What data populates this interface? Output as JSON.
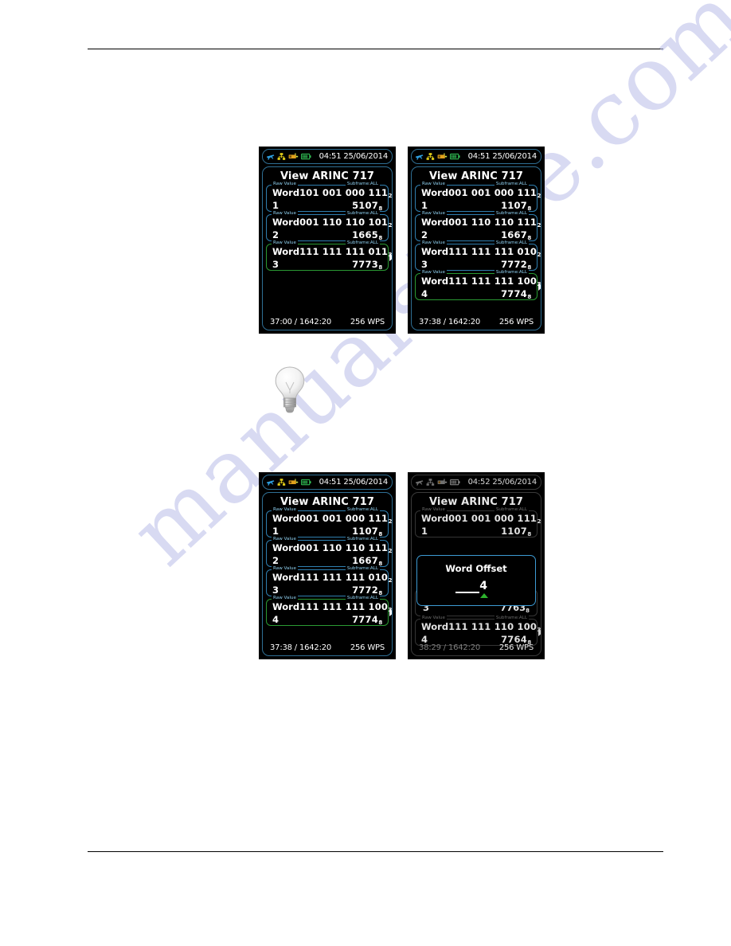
{
  "page": {
    "document_type": "manual-page",
    "watermark_text": "manualshive.com",
    "hint_icon": "light-bulb-icon"
  },
  "screens": [
    {
      "id": "screen-1",
      "position": "top-left",
      "dimmed": false,
      "statusbar": {
        "icons": [
          "airplane-icon",
          "network-icon",
          "device-icon",
          "battery-icon"
        ],
        "clock": "04:51 25/06/2014"
      },
      "title": "View ARINC 717",
      "legend_left": "Raw Value",
      "legend_right": "Subframe:ALL",
      "rows": [
        {
          "label": "Word",
          "index": "1",
          "binary": "101 001 000 111",
          "binary_sub": "2",
          "octal": "5107",
          "octal_sub": "8",
          "selected": false
        },
        {
          "label": "Word",
          "index": "2",
          "binary": "001 110 110 101",
          "binary_sub": "2",
          "octal": "1665",
          "octal_sub": "8",
          "selected": false
        },
        {
          "label": "Word",
          "index": "3",
          "binary": "111 111 111 011",
          "binary_sub": "2",
          "octal": "7773",
          "octal_sub": "8",
          "selected": true
        }
      ],
      "footer": {
        "elapsed": "37:00 / 1642:20",
        "rate": "256 WPS"
      },
      "modal": null
    },
    {
      "id": "screen-2",
      "position": "top-right",
      "dimmed": false,
      "statusbar": {
        "icons": [
          "airplane-icon",
          "network-icon",
          "device-icon",
          "battery-icon"
        ],
        "clock": "04:51 25/06/2014"
      },
      "title": "View ARINC 717",
      "legend_left": "Raw Value",
      "legend_right": "Subframe:ALL",
      "rows": [
        {
          "label": "Word",
          "index": "1",
          "binary": "001 001 000 111",
          "binary_sub": "2",
          "octal": "1107",
          "octal_sub": "8",
          "selected": false
        },
        {
          "label": "Word",
          "index": "2",
          "binary": "001 110 110 111",
          "binary_sub": "2",
          "octal": "1667",
          "octal_sub": "8",
          "selected": false
        },
        {
          "label": "Word",
          "index": "3",
          "binary": "111 111 111 010",
          "binary_sub": "2",
          "octal": "7772",
          "octal_sub": "8",
          "selected": false
        },
        {
          "label": "Word",
          "index": "4",
          "binary": "111 111 111 100",
          "binary_sub": "2",
          "octal": "7774",
          "octal_sub": "8",
          "selected": true
        }
      ],
      "footer": {
        "elapsed": "37:38 / 1642:20",
        "rate": "256 WPS"
      },
      "modal": null
    },
    {
      "id": "screen-3",
      "position": "bottom-left",
      "dimmed": false,
      "statusbar": {
        "icons": [
          "airplane-icon",
          "network-icon",
          "device-icon",
          "battery-icon"
        ],
        "clock": "04:51 25/06/2014"
      },
      "title": "View ARINC 717",
      "legend_left": "Raw Value",
      "legend_right": "Subframe:ALL",
      "rows": [
        {
          "label": "Word",
          "index": "1",
          "binary": "001 001 000 111",
          "binary_sub": "2",
          "octal": "1107",
          "octal_sub": "8",
          "selected": false
        },
        {
          "label": "Word",
          "index": "2",
          "binary": "001 110 110 111",
          "binary_sub": "2",
          "octal": "1667",
          "octal_sub": "8",
          "selected": false
        },
        {
          "label": "Word",
          "index": "3",
          "binary": "111 111 111 010",
          "binary_sub": "2",
          "octal": "7772",
          "octal_sub": "8",
          "selected": false
        },
        {
          "label": "Word",
          "index": "4",
          "binary": "111 111 111 100",
          "binary_sub": "2",
          "octal": "7774",
          "octal_sub": "8",
          "selected": true
        }
      ],
      "footer": {
        "elapsed": "37:38 / 1642:20",
        "rate": "256 WPS"
      },
      "modal": null
    },
    {
      "id": "screen-4",
      "position": "bottom-right",
      "dimmed": true,
      "statusbar": {
        "icons": [
          "airplane-icon",
          "network-icon",
          "device-icon",
          "battery-icon"
        ],
        "clock": "04:52 25/06/2014"
      },
      "title": "View ARINC 717",
      "legend_left": "Raw Value",
      "legend_right": "Subframe:ALL",
      "rows": [
        {
          "label": "Word",
          "index": "1",
          "binary": "001 001 000 111",
          "binary_sub": "2",
          "octal": "1107",
          "octal_sub": "8",
          "selected": false
        },
        {
          "label": "Word",
          "index": "4",
          "binary": "111 111 110 100",
          "binary_sub": "2",
          "octal": "7764",
          "octal_sub": "8",
          "selected": true
        }
      ],
      "partial_row": {
        "index": "3",
        "octal": "7763",
        "octal_sub": "8"
      },
      "footer": {
        "elapsed": "38:29 / 1642:20",
        "rate": "256 WPS"
      },
      "modal": {
        "title": "Word Offset",
        "value": "4",
        "caret_icon": "up-triangle-caret-icon"
      }
    }
  ],
  "colors": {
    "screen_background": "#000000",
    "frame_blue": "#2f6f94",
    "box_blue": "#2f7fb0",
    "selected_green": "#2a9a33",
    "legend_blue": "#8fd0f0",
    "text_white": "#ffffff",
    "caret_green": "#2db22d",
    "modal_border": "#3d9bd4",
    "dim_border": "#353535",
    "watermark": "#b9bce8"
  }
}
